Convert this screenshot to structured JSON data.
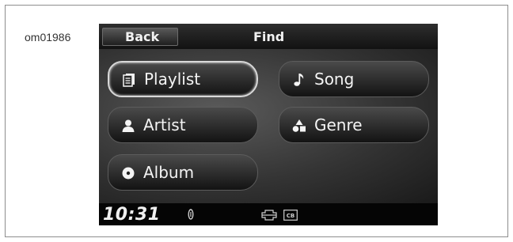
{
  "figure_code": "om01986",
  "header": {
    "back_label": "Back",
    "title": "Find"
  },
  "menu": {
    "playlist": {
      "label": "Playlist",
      "icon": "playlist-icon",
      "selected": true
    },
    "song": {
      "label": "Song",
      "icon": "music-note-icon"
    },
    "artist": {
      "label": "Artist",
      "icon": "person-icon"
    },
    "genre": {
      "label": "Genre",
      "icon": "genre-icon"
    },
    "album": {
      "label": "Album",
      "icon": "disc-icon"
    }
  },
  "status_bar": {
    "time": "10:31",
    "icons": [
      "mic-icon",
      "brand-logo-icon",
      "cb-icon"
    ],
    "cb_text": "CB"
  }
}
